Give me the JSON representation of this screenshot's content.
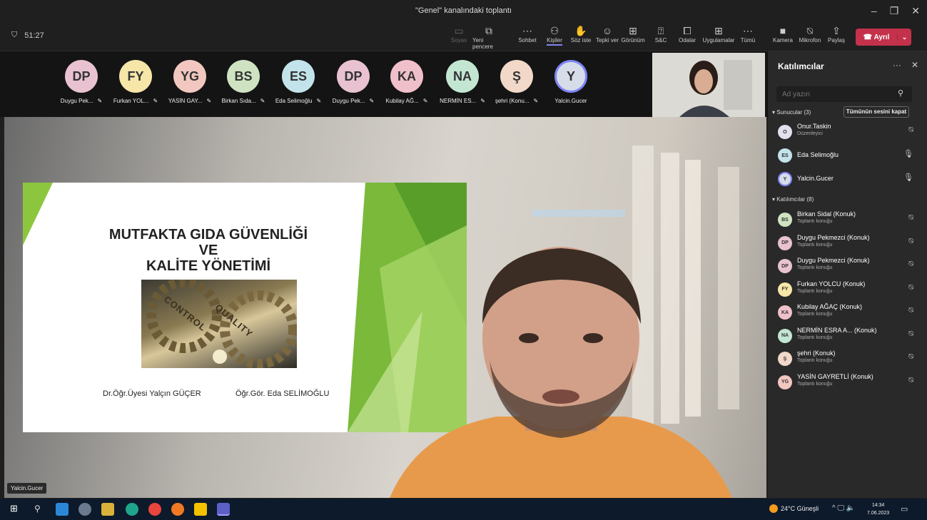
{
  "window": {
    "title": "\"Genel\" kanalındaki toplantı",
    "minimize": "–",
    "restore": "❐",
    "close": "✕"
  },
  "meeting": {
    "timer": "51:27",
    "shield": "⛉"
  },
  "toolbar": {
    "items": [
      {
        "label": "Soyas",
        "icon": "▭",
        "disabled": true
      },
      {
        "label": "Yeni pencere",
        "icon": "⧉"
      },
      {
        "label": "Sohbet",
        "icon": "⋯"
      },
      {
        "label": "Kişiler",
        "icon": "⚇",
        "active": true
      },
      {
        "label": "Söz iste",
        "icon": "✋"
      },
      {
        "label": "Tepki ver",
        "icon": "☺"
      },
      {
        "label": "Görünüm",
        "icon": "⊞"
      },
      {
        "label": "S&C",
        "icon": "⍰"
      },
      {
        "label": "Odalar",
        "icon": "⧠"
      },
      {
        "label": "Uygulamalar",
        "icon": "⊞"
      },
      {
        "label": "Tümü",
        "icon": "⋯"
      },
      {
        "label": "Kamera",
        "icon": "■"
      },
      {
        "label": "Mikrofon",
        "icon": "⍉"
      },
      {
        "label": "Paylaş",
        "icon": "⇪"
      }
    ],
    "leave": {
      "label": "Ayrıl",
      "icon": "☎",
      "dropdown": "⌄"
    }
  },
  "strip": {
    "avatars": [
      {
        "initials": "DP",
        "name": "Duygu Pek...",
        "color": "#e9c2d1"
      },
      {
        "initials": "FY",
        "name": "Furkan YOL...",
        "color": "#f6e6a8"
      },
      {
        "initials": "YG",
        "name": "YASİN GAY...",
        "color": "#f2c7c0"
      },
      {
        "initials": "BS",
        "name": "Birkan Sıda...",
        "color": "#cfe3c2"
      },
      {
        "initials": "ES",
        "name": "Eda Selimoğlu",
        "color": "#c3e3ea"
      },
      {
        "initials": "DP",
        "name": "Duygu Pek...",
        "color": "#e9c2d1"
      },
      {
        "initials": "KA",
        "name": "Kubilay AĞ...",
        "color": "#f0c0ca"
      },
      {
        "initials": "NA",
        "name": "NERMİN ES...",
        "color": "#c3e6d3"
      },
      {
        "initials": "Ş",
        "name": "şehri (Konu...",
        "color": "#f2d8c9"
      },
      {
        "initials": "Y",
        "name": "Yalcin.Gucer",
        "color": "#d6dde8"
      }
    ],
    "pin_icon": "✎"
  },
  "slide": {
    "title_line1": "MUTFAKTA GIDA GÜVENLİĞİ VE",
    "title_line2": "KALİTE YÖNETİMİ",
    "gear_word1": "CONTROL",
    "gear_word2": "QUALITY",
    "author1": "Dr.Öğr.Üyesi Yalçın GÜÇER",
    "author2": "Öğr.Gör. Eda SELİMOĞLU"
  },
  "stage": {
    "speaker_label": "Yalcin.Gucer"
  },
  "panel": {
    "title": "Katılımcılar",
    "more": "···",
    "close": "✕",
    "search_placeholder": "Ad yazın",
    "search_icon": "⚲",
    "presenters_header": "▾ Sunucular (3)",
    "mute_all": "Tümünün sesini kapat",
    "presenters": [
      {
        "initials": "O",
        "name": "Onur.Taskin",
        "sub": "Düzenleyici",
        "mic": "⍉",
        "color": "#e3e0ee"
      },
      {
        "initials": "ES",
        "name": "Eda Selimoğlu",
        "sub": "",
        "mic": "🎙",
        "color": "#c3e3ea"
      },
      {
        "initials": "Y",
        "name": "Yalcin.Gucer",
        "sub": "",
        "mic": "🎙",
        "color": "#d6dde8"
      }
    ],
    "attendees_header": "▾ Katılımcılar (8)",
    "attendees": [
      {
        "initials": "BS",
        "name": "Birkan Sidal (Konuk)",
        "sub": "Toplantı konuğu",
        "color": "#cfe3c2"
      },
      {
        "initials": "DP",
        "name": "Duygu Pekmezci (Konuk)",
        "sub": "Toplantı konuğu",
        "color": "#e9c2d1"
      },
      {
        "initials": "DP",
        "name": "Duygu Pekmezci (Konuk)",
        "sub": "Toplantı konuğu",
        "color": "#e9c2d1"
      },
      {
        "initials": "FY",
        "name": "Furkan YOLCU (Konuk)",
        "sub": "Toplantı konuğu",
        "color": "#f6e6a8"
      },
      {
        "initials": "KA",
        "name": "Kubilay AĞAÇ (Konuk)",
        "sub": "Toplantı konuğu",
        "color": "#f0c0ca"
      },
      {
        "initials": "NA",
        "name": "NERMİN ESRA A... (Konuk)",
        "sub": "Toplantı konuğu",
        "color": "#c3e6d3"
      },
      {
        "initials": "Ş",
        "name": "şehri (Konuk)",
        "sub": "Toplantı konuğu",
        "color": "#f2d8c9"
      },
      {
        "initials": "YG",
        "name": "YASİN GAYRETLİ (Konuk)",
        "sub": "Toplantı konuğu",
        "color": "#f2c7c0"
      }
    ],
    "mute_icon": "⍉"
  },
  "taskbar": {
    "start": "⊞",
    "search": "⚲",
    "weather": "24°C Güneşli",
    "tray": "^ 🖵 🔈",
    "time": "14:34",
    "date": "7.06.2023",
    "notification_icon": "▭"
  }
}
